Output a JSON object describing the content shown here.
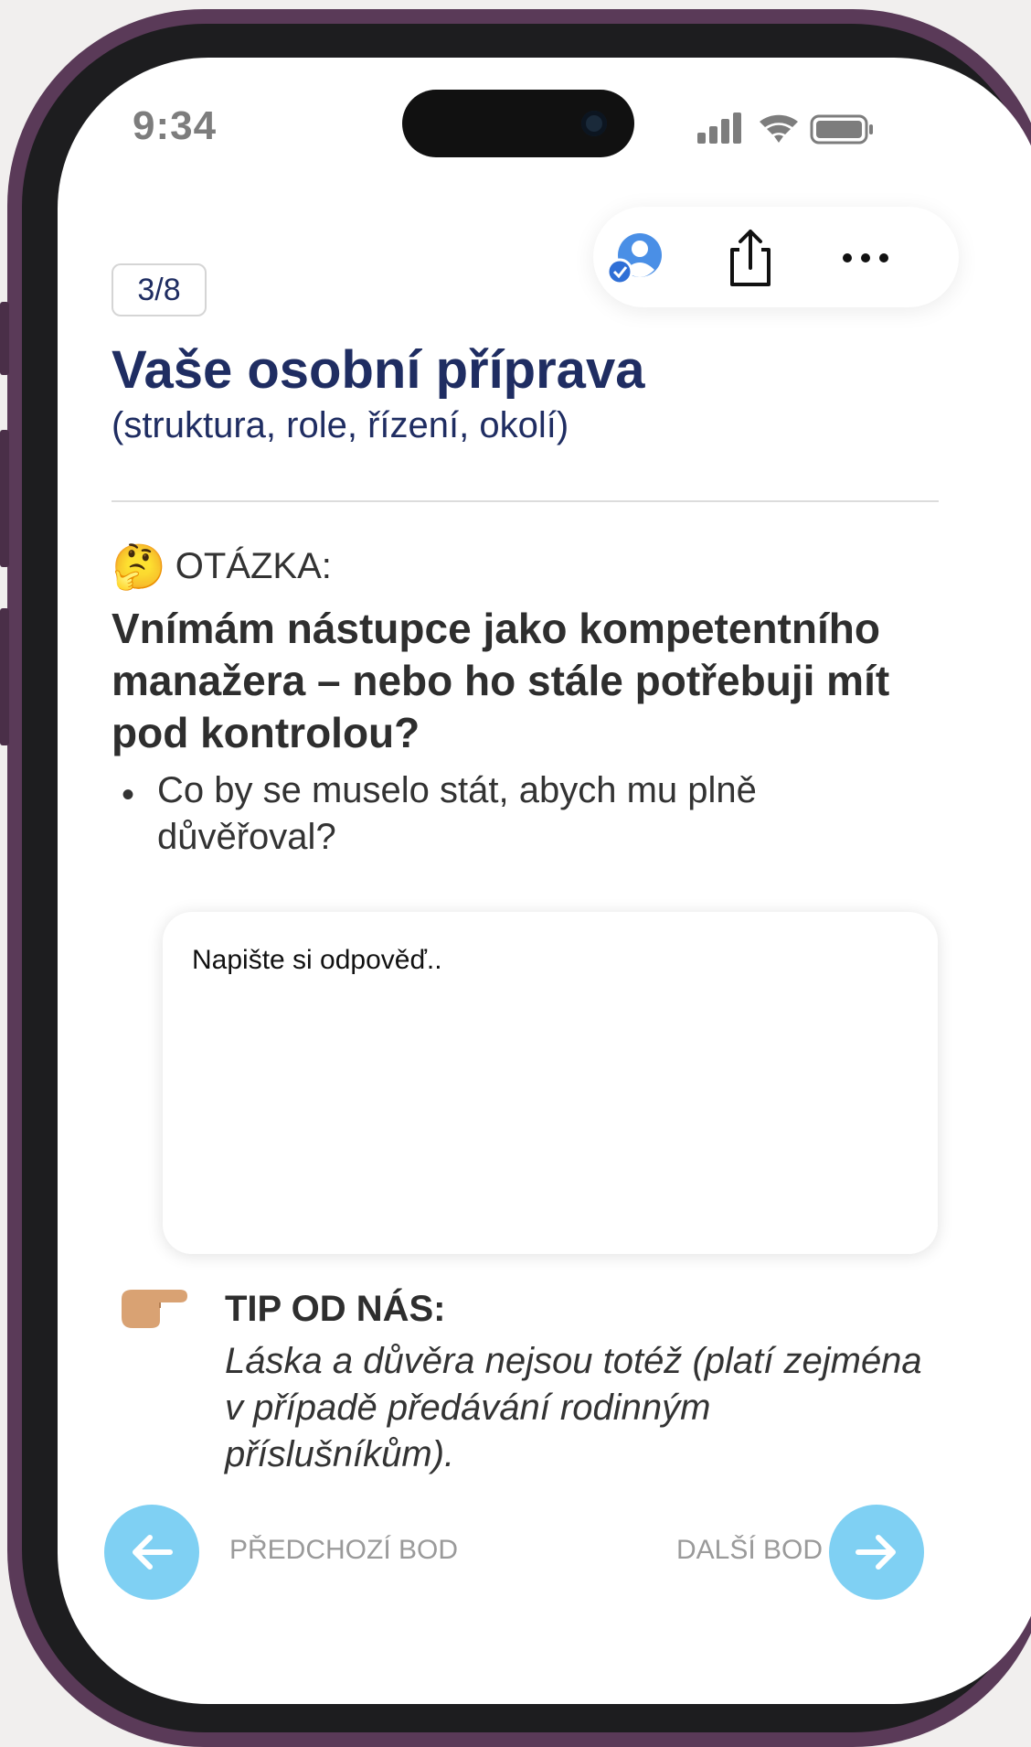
{
  "status_bar": {
    "time": "9:34"
  },
  "toolbar": {
    "profile_icon": "user-check-icon",
    "share_icon": "share-icon",
    "more_icon": "more-icon"
  },
  "page": {
    "counter": "3/8",
    "title": "Vaše osobní příprava",
    "subtitle": "(struktura, role, řízení, okolí)"
  },
  "question": {
    "label": "OTÁZKA:",
    "emoji": "🤔",
    "text": "Vnímám nástupce jako kompetentního manažera – nebo ho stále potřebuji mít pod kontrolou?",
    "bullet": "Co by se muselo stát, abych mu plně důvěřoval?"
  },
  "answer": {
    "placeholder": "Napište si odpověď.."
  },
  "tip": {
    "emoji": "👉",
    "title": "TIP OD NÁS:",
    "text": "Láska a důvěra nejsou totéž (platí zejména v případě předávání rodinným příslušníkům)."
  },
  "navigation": {
    "prev_label": "PŘEDCHOZÍ BOD",
    "next_label": "DALŠÍ BOD"
  },
  "colors": {
    "accent": "#1f2d62",
    "nav": "#7fd0f3",
    "frame": "#5a3a58"
  }
}
